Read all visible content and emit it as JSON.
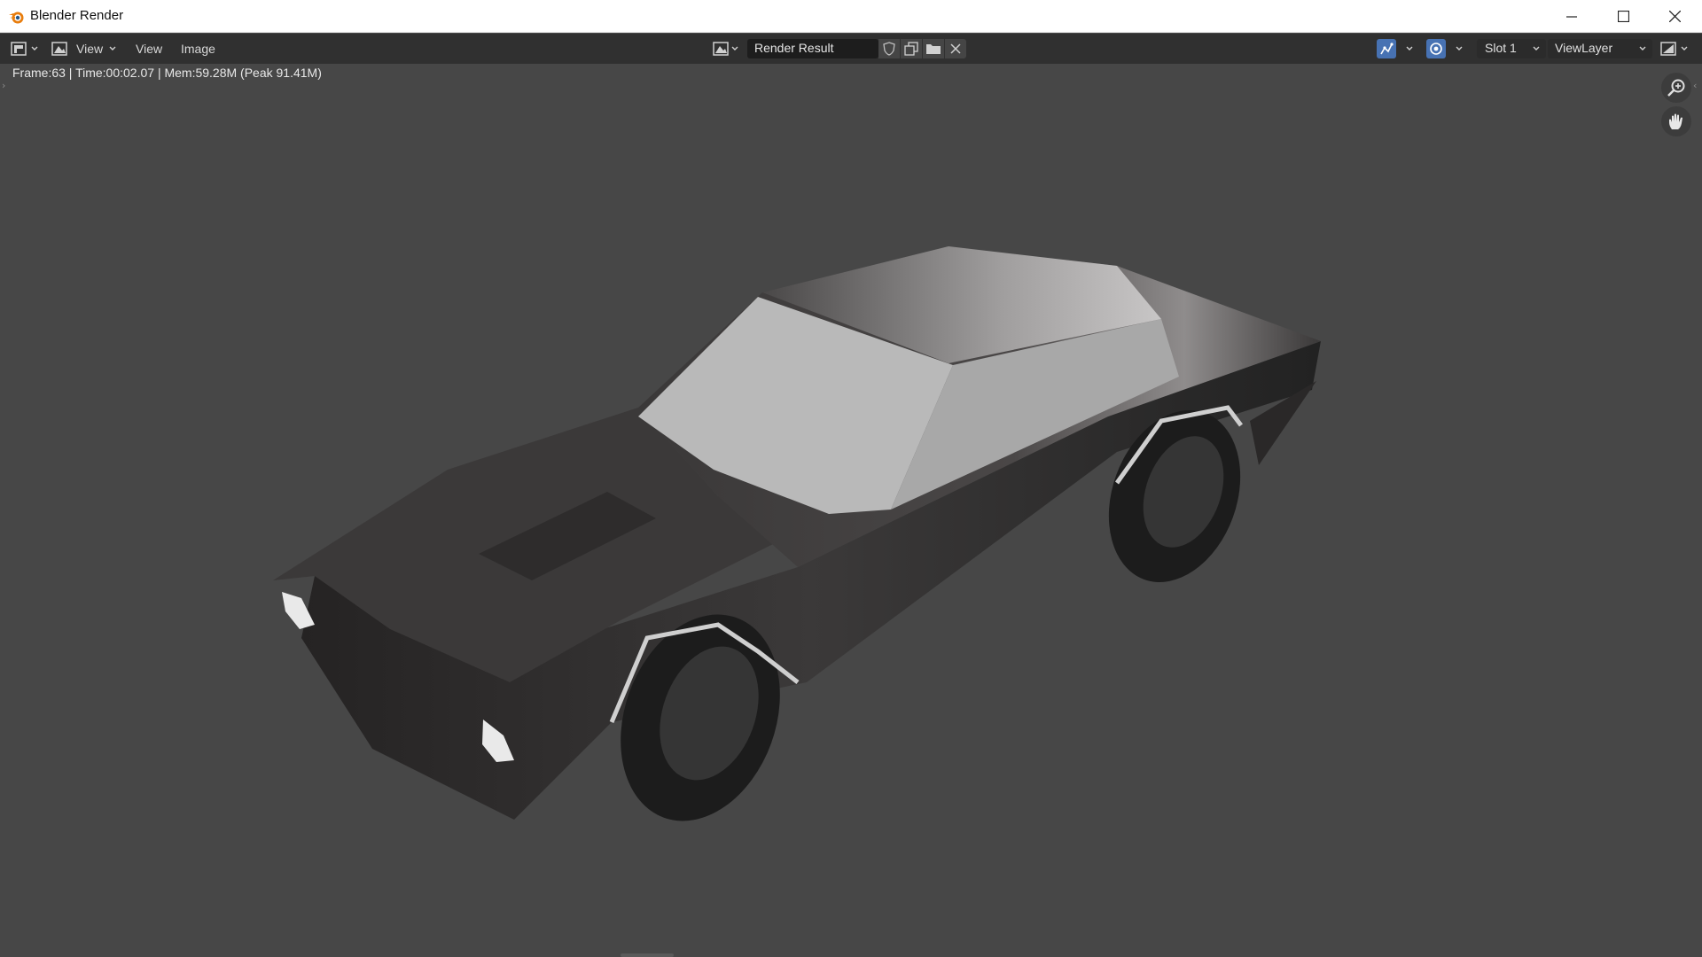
{
  "window": {
    "title": "Blender Render",
    "icon": "blender-logo-icon",
    "controls": [
      "minimize-icon",
      "maximize-icon",
      "close-icon"
    ]
  },
  "header": {
    "editor_type_icon": "image-editor-icon",
    "view_mode_label": "View",
    "menus": {
      "view": "View",
      "image": "Image"
    },
    "image_name": "Render Result",
    "image_actions": [
      "fake-user-shield-icon",
      "new-image-icon",
      "open-folder-icon",
      "unlink-x-icon"
    ],
    "slot": "Slot 1",
    "view_layer": "ViewLayer",
    "accent_color": "#4772b3"
  },
  "render_info": "Frame:63 | Time:00:02.07 | Mem:59.28M (Peak 91.41M)",
  "viewport": {
    "background_color": "#474747",
    "navigation": [
      "zoom-icon",
      "hand-pan-icon"
    ]
  }
}
